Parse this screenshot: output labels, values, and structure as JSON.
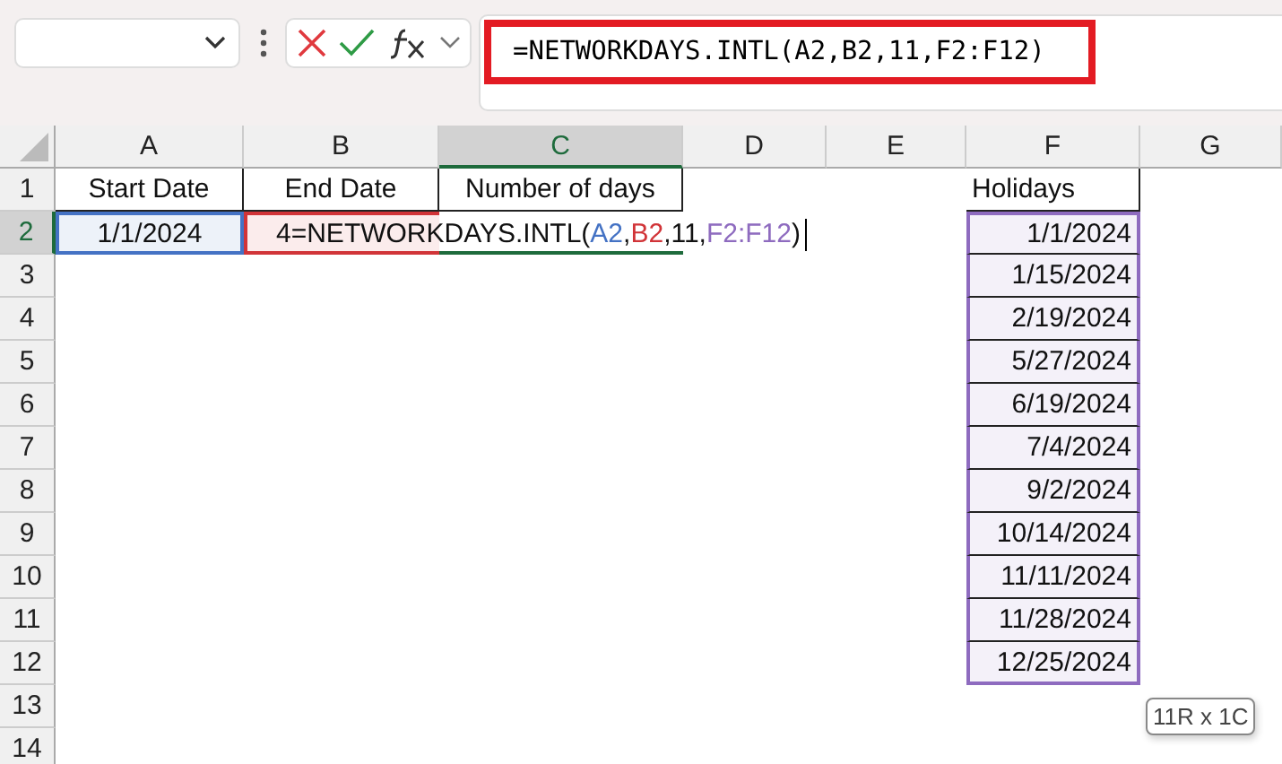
{
  "formula_bar": {
    "formula": "=NETWORKDAYS.INTL(A2,B2,11,F2:F12)",
    "outlined": true
  },
  "columns": [
    {
      "label": "A",
      "selected": false
    },
    {
      "label": "B",
      "selected": false
    },
    {
      "label": "C",
      "selected": true
    },
    {
      "label": "D",
      "selected": false
    },
    {
      "label": "E",
      "selected": false
    },
    {
      "label": "F",
      "selected": false
    },
    {
      "label": "G",
      "selected": false
    }
  ],
  "rows": [
    {
      "label": "1",
      "selected": false,
      "cells": {
        "A": {
          "text": "Start Date",
          "kind": "heading",
          "bordered": true
        },
        "B": {
          "text": "End Date",
          "kind": "heading",
          "bordered": true
        },
        "C": {
          "text": "Number of days",
          "kind": "heading",
          "bordered": true
        },
        "F": {
          "text": "Holidays",
          "kind": "label",
          "bordered": true
        }
      }
    },
    {
      "label": "2",
      "selected": true,
      "cells": {
        "A": {
          "text": "1/1/2024",
          "kind": "heading",
          "color": "#4472c4"
        },
        "B": {
          "parts": [
            {
              "text": "4=NETWORKDAYS.INTL("
            },
            {
              "text": "A2",
              "color": "#4472c4"
            },
            {
              "text": ","
            },
            {
              "text": "B2",
              "color": "#d13438"
            },
            {
              "text": ",11,"
            },
            {
              "text": "F2:F12",
              "color": "#8e6bbf"
            },
            {
              "text": ")"
            }
          ],
          "kind": "formula",
          "color": "#d13438",
          "editing": true
        },
        "C": {
          "active": true
        },
        "F": {
          "text": "1/1/2024",
          "kind": "date",
          "bordered": true,
          "color": "#8e6bbf"
        }
      }
    },
    {
      "label": "3",
      "selected": false,
      "cells": {
        "F": {
          "text": "1/15/2024",
          "kind": "date",
          "bordered": true,
          "color": "#8e6bbf"
        }
      }
    },
    {
      "label": "4",
      "selected": false,
      "cells": {
        "F": {
          "text": "2/19/2024",
          "kind": "date",
          "bordered": true,
          "color": "#8e6bbf"
        }
      }
    },
    {
      "label": "5",
      "selected": false,
      "cells": {
        "F": {
          "text": "5/27/2024",
          "kind": "date",
          "bordered": true,
          "color": "#8e6bbf"
        }
      }
    },
    {
      "label": "6",
      "selected": false,
      "cells": {
        "F": {
          "text": "6/19/2024",
          "kind": "date",
          "bordered": true,
          "color": "#8e6bbf"
        }
      }
    },
    {
      "label": "7",
      "selected": false,
      "cells": {
        "F": {
          "text": "7/4/2024",
          "kind": "date",
          "bordered": true,
          "color": "#8e6bbf"
        }
      }
    },
    {
      "label": "8",
      "selected": false,
      "cells": {
        "F": {
          "text": "9/2/2024",
          "kind": "date",
          "bordered": true,
          "color": "#8e6bbf"
        }
      }
    },
    {
      "label": "9",
      "selected": false,
      "cells": {
        "F": {
          "text": "10/14/2024",
          "kind": "date",
          "bordered": true,
          "color": "#8e6bbf"
        }
      }
    },
    {
      "label": "10",
      "selected": false,
      "cells": {
        "F": {
          "text": "11/11/2024",
          "kind": "date",
          "bordered": true,
          "color": "#8e6bbf"
        }
      }
    },
    {
      "label": "11",
      "selected": false,
      "cells": {
        "F": {
          "text": "11/28/2024",
          "kind": "date",
          "bordered": true,
          "color": "#8e6bbf"
        }
      }
    },
    {
      "label": "12",
      "selected": false,
      "cells": {
        "F": {
          "text": "12/25/2024",
          "kind": "date",
          "bordered": true,
          "color": "#8e6bbf"
        }
      }
    },
    {
      "label": "13",
      "selected": false,
      "cells": {}
    },
    {
      "label": "14",
      "selected": false,
      "cells": {}
    }
  ],
  "selection_tooltip": "11R x 1C"
}
